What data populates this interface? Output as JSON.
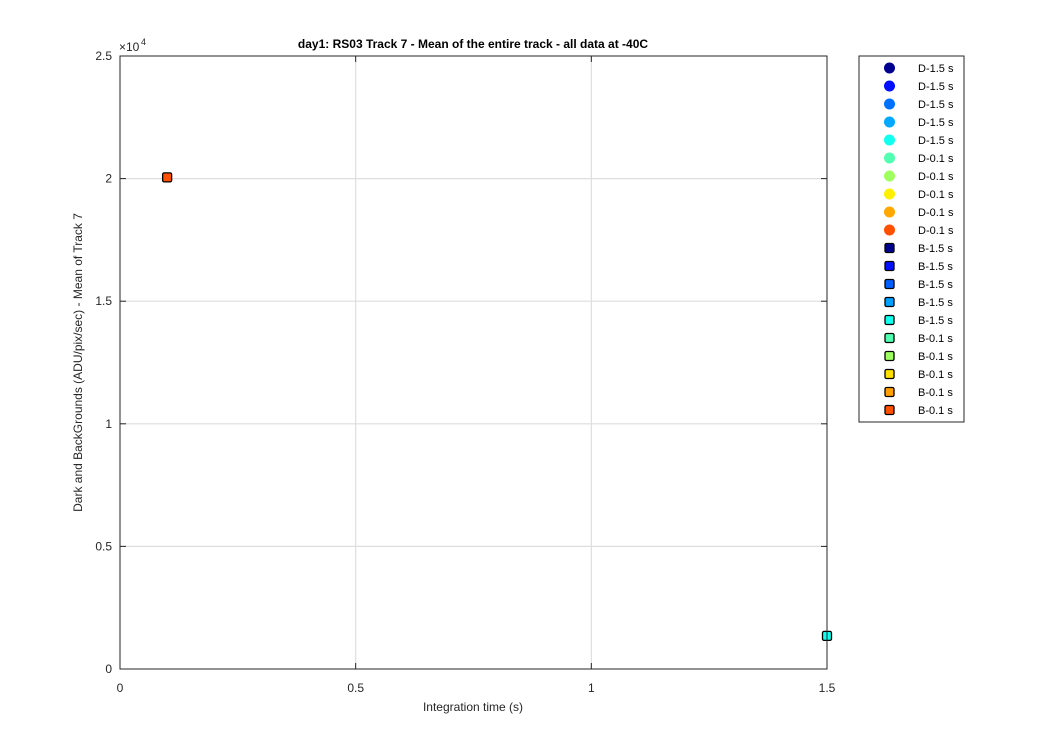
{
  "chart_data": {
    "type": "scatter",
    "title": "day1: RS03  Track 7 - Mean of the entire track - all data at -40C",
    "xlabel": "Integration time (s)",
    "ylabel": "Dark and BackGrounds (ADU/pix/sec) - Mean of Track 7",
    "y_exponent_label": "×10",
    "y_exponent": "4",
    "xlim": [
      0,
      1.5
    ],
    "ylim": [
      0,
      25000
    ],
    "x_ticks": [
      0,
      0.5,
      1,
      1.5
    ],
    "x_tick_labels": [
      "0",
      "0.5",
      "1",
      "1.5"
    ],
    "y_ticks": [
      0,
      5000,
      10000,
      15000,
      20000,
      25000
    ],
    "y_tick_labels": [
      "0",
      "0.5",
      "1",
      "1.5",
      "2",
      "2.5"
    ],
    "grid": true,
    "legend_position": "outside-right",
    "series": [
      {
        "name": "D-1.5 s",
        "marker": "circle",
        "color": "#00008f",
        "points": []
      },
      {
        "name": "D-1.5 s",
        "marker": "circle",
        "color": "#0010ff",
        "points": []
      },
      {
        "name": "D-1.5 s",
        "marker": "circle",
        "color": "#0070ff",
        "points": []
      },
      {
        "name": "D-1.5 s",
        "marker": "circle",
        "color": "#00a8ff",
        "points": []
      },
      {
        "name": "D-1.5 s",
        "marker": "circle",
        "color": "#10ffef",
        "points": []
      },
      {
        "name": "D-0.1 s",
        "marker": "circle",
        "color": "#50ffaf",
        "points": []
      },
      {
        "name": "D-0.1 s",
        "marker": "circle",
        "color": "#9fff60",
        "points": []
      },
      {
        "name": "D-0.1 s",
        "marker": "circle",
        "color": "#ffef00",
        "points": []
      },
      {
        "name": "D-0.1 s",
        "marker": "circle",
        "color": "#ffa800",
        "points": []
      },
      {
        "name": "D-0.1 s",
        "marker": "circle",
        "color": "#ff5000",
        "points": []
      },
      {
        "name": "B-1.5 s",
        "marker": "square",
        "color": "#00008f",
        "points": []
      },
      {
        "name": "B-1.5 s",
        "marker": "square",
        "color": "#0010ff",
        "points": []
      },
      {
        "name": "B-1.5 s",
        "marker": "square",
        "color": "#0060ff",
        "points": []
      },
      {
        "name": "B-1.5 s",
        "marker": "square",
        "color": "#00a0ff",
        "points": []
      },
      {
        "name": "B-1.5 s",
        "marker": "square",
        "color": "#10ffef",
        "points": [
          [
            1.5,
            1350
          ]
        ]
      },
      {
        "name": "B-0.1 s",
        "marker": "square",
        "color": "#50ffaf",
        "points": []
      },
      {
        "name": "B-0.1 s",
        "marker": "square",
        "color": "#9fff60",
        "points": []
      },
      {
        "name": "B-0.1 s",
        "marker": "square",
        "color": "#ffe000",
        "points": []
      },
      {
        "name": "B-0.1 s",
        "marker": "square",
        "color": "#ffa000",
        "points": []
      },
      {
        "name": "B-0.1 s",
        "marker": "square",
        "color": "#ff5000",
        "points": [
          [
            0.1,
            20050
          ]
        ]
      }
    ]
  }
}
